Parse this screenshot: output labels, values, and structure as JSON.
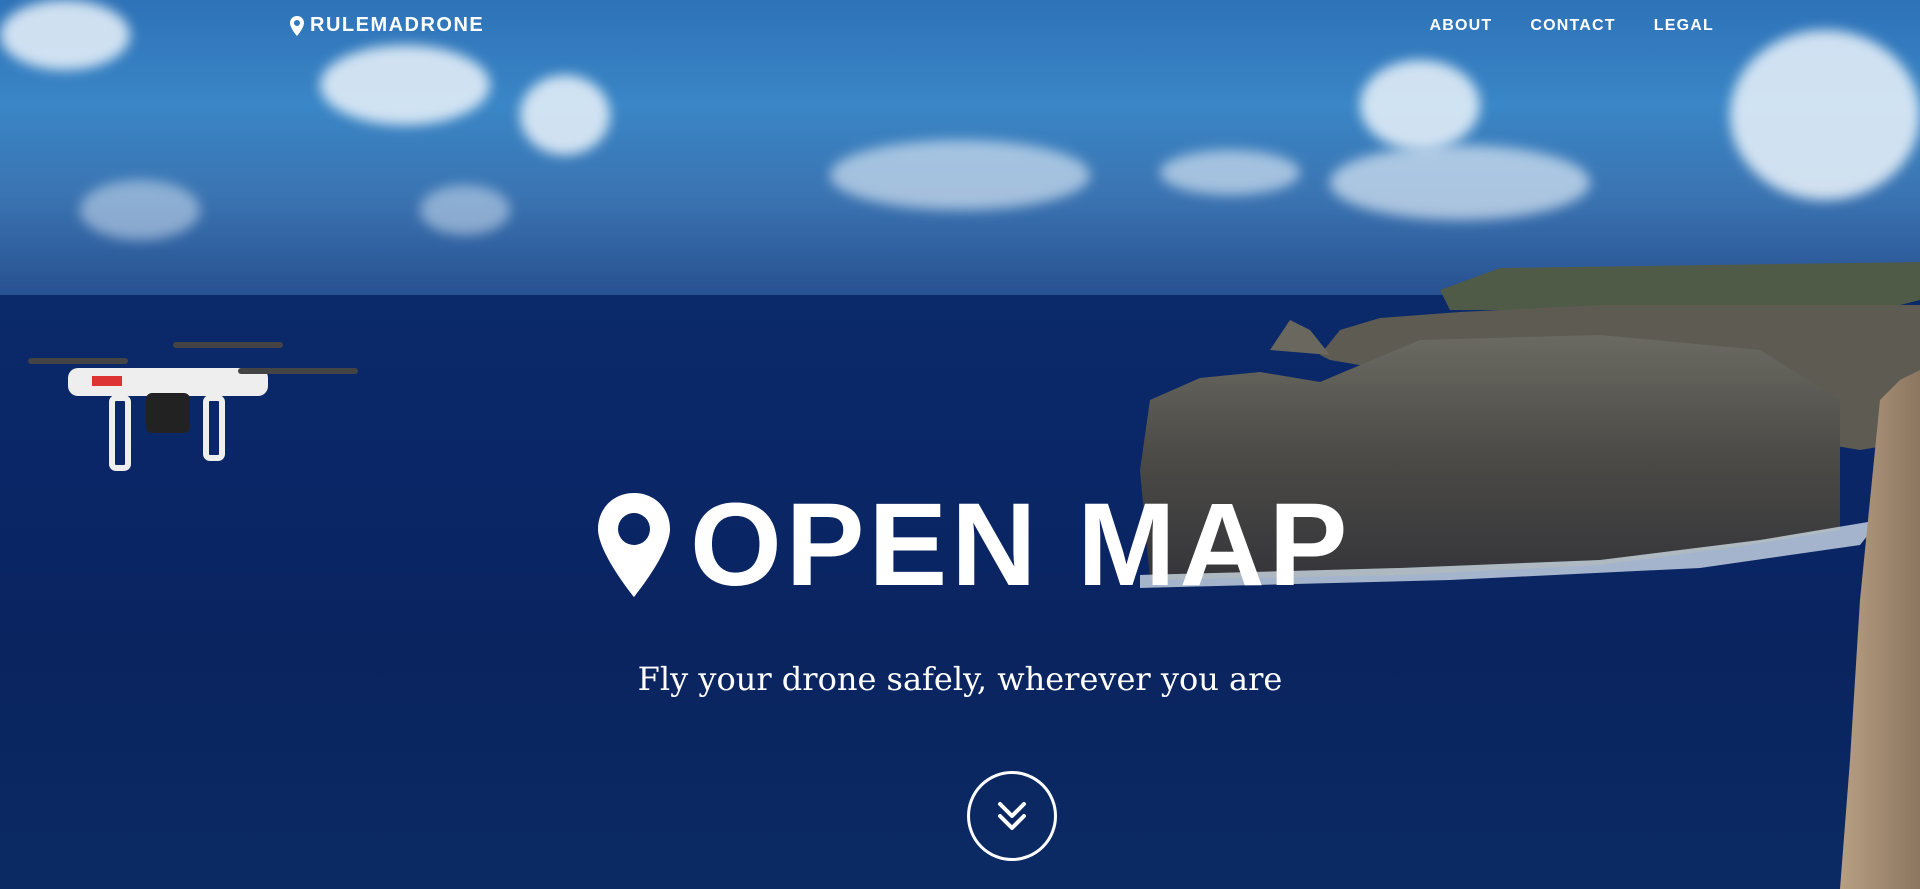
{
  "header": {
    "brand": "RULEMADRONE",
    "brand_icon": "map-marker-icon",
    "nav": [
      {
        "label": "ABOUT"
      },
      {
        "label": "CONTACT"
      },
      {
        "label": "LEGAL"
      }
    ]
  },
  "hero": {
    "title": "OPEN MAP",
    "title_icon": "map-marker-icon",
    "subtitle": "Fly your drone safely, wherever you are",
    "scroll_icon": "double-chevron-down-icon"
  },
  "colors": {
    "text": "#ffffff",
    "sea": "#0a2666",
    "sky": "#3a86c6"
  }
}
